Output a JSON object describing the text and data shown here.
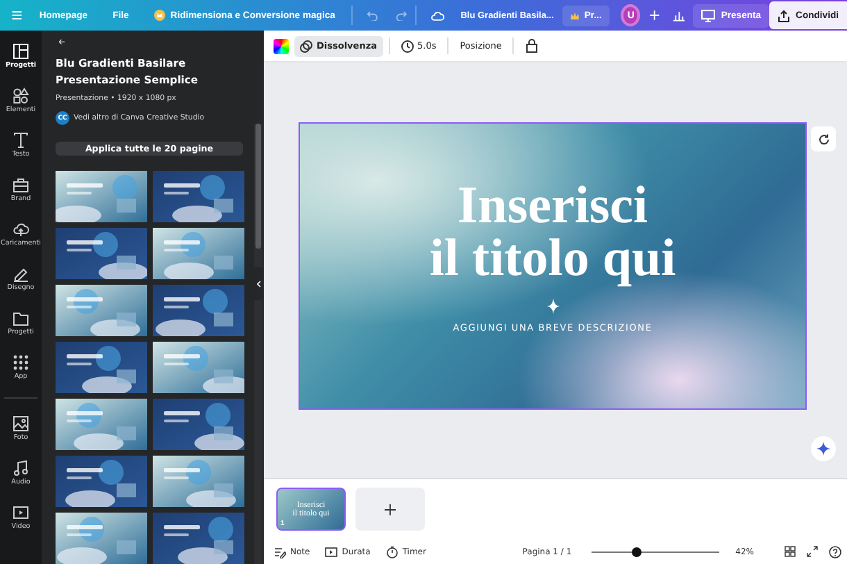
{
  "top_bar": {
    "nav": [
      "Homepage",
      "File"
    ],
    "magic": "Ridimensiona e Conversione magica",
    "doc_title": "Blu Gradienti Basila...",
    "pro": "Pr...",
    "avatar": "U",
    "present": "Presenta",
    "share": "Condividi"
  },
  "rail": [
    {
      "label": "Progetti",
      "selected": true
    },
    {
      "label": "Elementi",
      "selected": false
    },
    {
      "label": "Testo",
      "selected": false
    },
    {
      "label": "Brand",
      "selected": false
    },
    {
      "label": "Caricamenti",
      "selected": false
    },
    {
      "label": "Disegno",
      "selected": false
    },
    {
      "label": "Progetti",
      "selected": false
    },
    {
      "label": "App",
      "selected": false
    },
    {
      "label": "Foto",
      "selected": false
    },
    {
      "label": "Audio",
      "selected": false
    },
    {
      "label": "Video",
      "selected": false
    }
  ],
  "panel": {
    "title": "Blu Gradienti Basilare Presentazione Semplice",
    "meta": "Presentazione • 1920 x 1080 px",
    "author_badge": "CC",
    "author": "Vedi altro di Canva Creative Studio",
    "apply": "Applica tutte le 20 pagine"
  },
  "toolbar": {
    "transition": {
      "label": "Dissolvenza",
      "selected": true
    },
    "duration": "5.0s",
    "position": "Posizione"
  },
  "slide": {
    "title_lines": [
      "Inserisci",
      "il titolo qui"
    ],
    "subtitle": "AGGIUNGI UNA BREVE DESCRIZIONE"
  },
  "pages": [
    {
      "number": "1",
      "selected": true,
      "thumb_lines": [
        "Inserisci",
        "il titolo qui"
      ]
    }
  ],
  "footer": {
    "notes": "Note",
    "duration": "Durata",
    "timer": "Timer",
    "page": "Pagina 1 / 1",
    "zoom": {
      "level": 0.36
    },
    "zoom_label": "42%"
  }
}
